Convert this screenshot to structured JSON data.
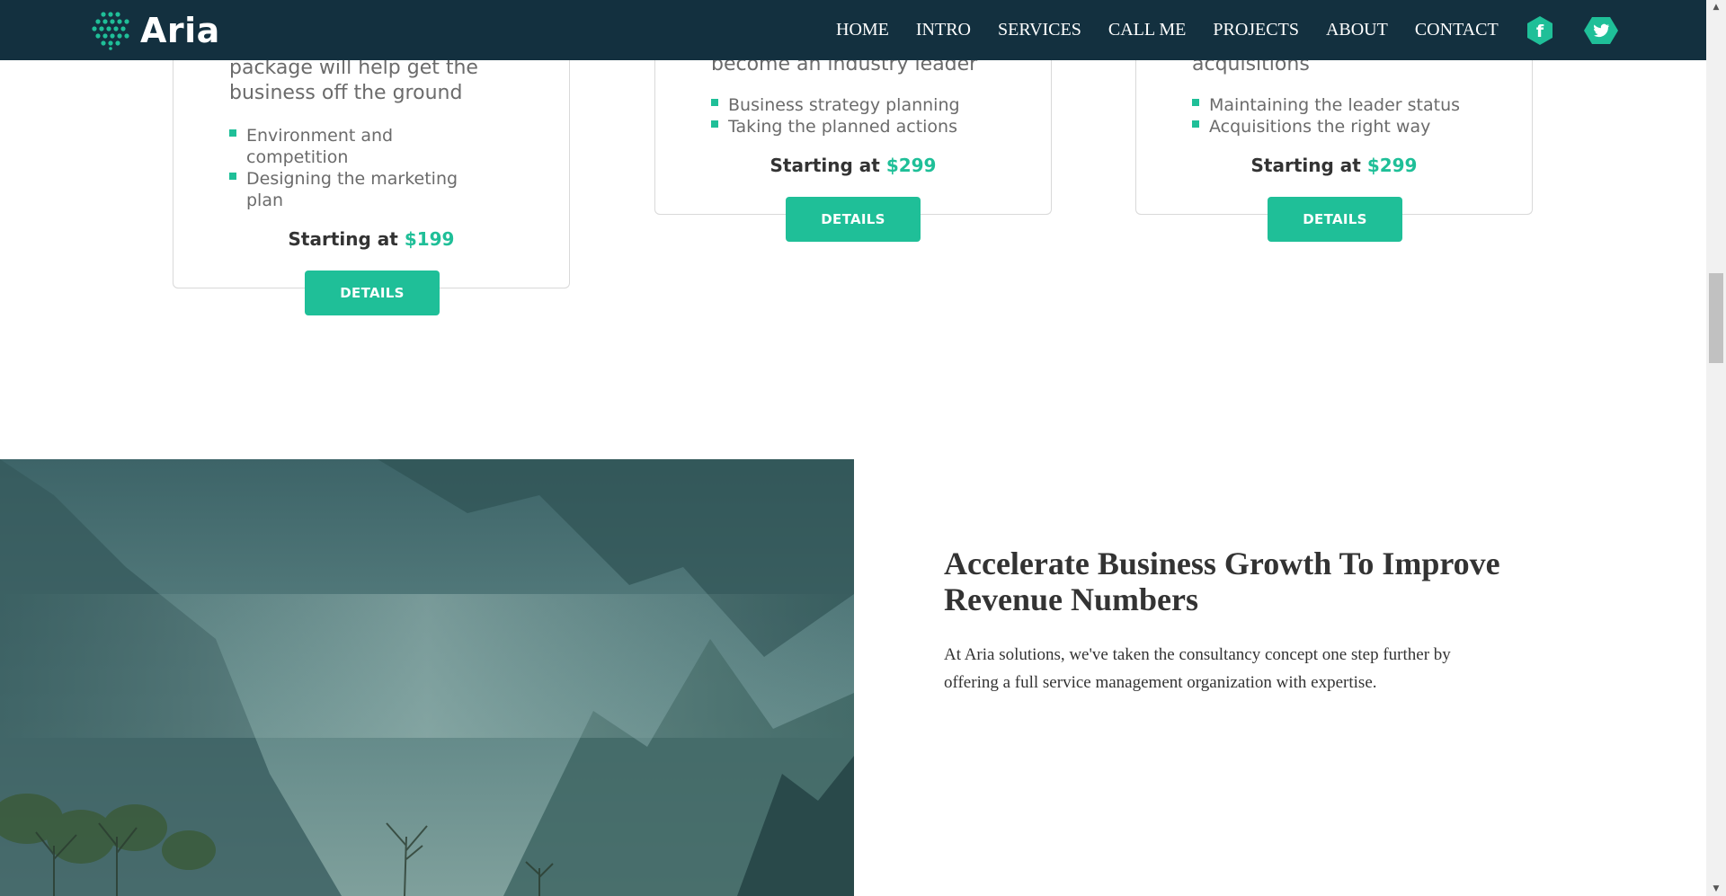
{
  "brand": {
    "name": "Aria",
    "accent": "#1fbf98",
    "nav_bg": "#13303f"
  },
  "nav": {
    "links": [
      "HOME",
      "INTRO",
      "SERVICES",
      "CALL ME",
      "PROJECTS",
      "ABOUT",
      "CONTACT"
    ],
    "social": [
      {
        "icon": "facebook-icon",
        "glyph": "f"
      },
      {
        "icon": "twitter-icon"
      }
    ]
  },
  "pricing": {
    "cards": [
      {
        "description": "package will help get the business off the ground",
        "features": [
          "Environment and competition",
          "Designing the marketing plan"
        ],
        "price_label": "Starting at",
        "price_amount": "$199",
        "button_label": "DETAILS"
      },
      {
        "description": "become an industry leader",
        "features": [
          "Business strategy planning",
          "Taking the planned actions"
        ],
        "price_label": "Starting at",
        "price_amount": "$299",
        "button_label": "DETAILS"
      },
      {
        "description": "acquisitions",
        "features": [
          "Maintaining the leader status",
          "Acquisitions the right way"
        ],
        "price_label": "Starting at",
        "price_amount": "$299",
        "button_label": "DETAILS"
      }
    ]
  },
  "about": {
    "title": "Accelerate Business Growth To Improve Revenue Numbers",
    "text": "At Aria solutions, we've taken the consultancy concept one step further by offering a full service management organization with expertise."
  }
}
